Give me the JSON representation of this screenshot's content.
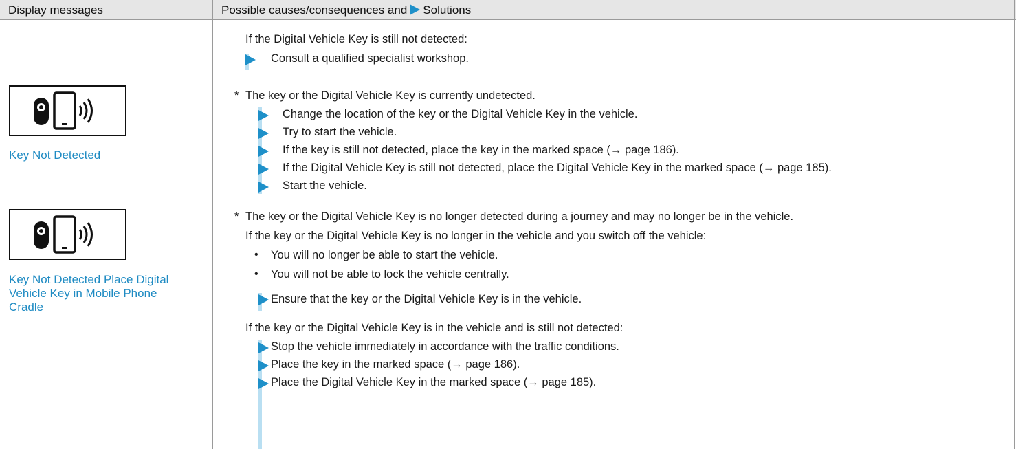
{
  "header": {
    "col1": "Display messages",
    "col2_prefix": "Possible causes/consequences and",
    "col2_suffix": "Solutions",
    "col2_icon": "arrow-right-triangle"
  },
  "row0": {
    "line1": "If the Digital Vehicle Key is still not detected:",
    "step1": "Consult a qualified specialist workshop."
  },
  "row1": {
    "icon": "key-phone-signal",
    "message": "Key Not Detected",
    "cause": "The key or the Digital Vehicle Key is currently undetected.",
    "steps": [
      "Change the location of the key or the Digital Vehicle Key in the vehicle.",
      "Try to start the vehicle.",
      "If the key is still not detected, place the key in the marked space (→ page 186).",
      "If the Digital Vehicle Key is still not detected, place the Digital Vehicle Key in the marked space (→ page 185).",
      "Start the vehicle."
    ]
  },
  "row2": {
    "icon": "key-phone-signal",
    "message": "Key Not Detected Place Digital Vehicle Key in Mobile Phone Cradle",
    "cause": "The key or the Digital Vehicle Key is no longer detected during a journey and may no longer be in the vehicle.",
    "condition1": "If the key or the Digital Vehicle Key is no longer in the vehicle and you switch off the vehicle:",
    "bullets": [
      "You will no longer be able to start the vehicle.",
      "You will not be able to lock the vehicle centrally."
    ],
    "step1": "Ensure that the key or the Digital Vehicle Key is in the vehicle.",
    "condition2": "If the key or the Digital Vehicle Key is in the vehicle and is still not detected:",
    "steps": [
      "Stop the vehicle immediately in accordance with the traffic conditions.",
      "Place the key in the marked space (→ page 186).",
      "Place the Digital Vehicle Key in the marked space (→ page 185)."
    ]
  },
  "colors": {
    "accent": "#1e90c9",
    "message": "#1f8bc3",
    "header_bg": "#e6e6e6"
  }
}
